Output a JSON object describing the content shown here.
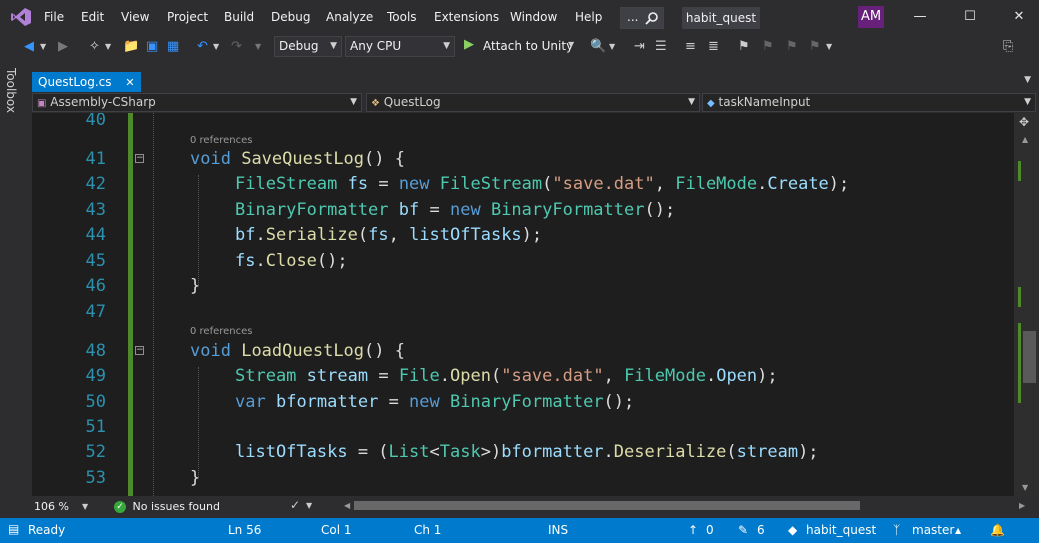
{
  "menu": {
    "items": [
      "File",
      "Edit",
      "View",
      "Project",
      "Build",
      "Debug",
      "Analyze",
      "Tools",
      "Extensions",
      "Window",
      "Help"
    ],
    "search_ellipsis": "...",
    "solution_name": "habit_quest",
    "avatar_initials": "AM"
  },
  "toolbar": {
    "configuration": "Debug",
    "platform": "Any CPU",
    "attach_label": "Attach to Unity"
  },
  "sidebar": {
    "toolbox_label": "Toolbox"
  },
  "tabs": {
    "active_file": "QuestLog.cs",
    "close_glyph": "✕"
  },
  "nav": {
    "project": "Assembly-CSharp",
    "type": "QuestLog",
    "member": "taskNameInput"
  },
  "editor": {
    "line_numbers": [
      "40",
      "41",
      "42",
      "43",
      "44",
      "45",
      "46",
      "47",
      "48",
      "49",
      "50",
      "51",
      "52",
      "53"
    ],
    "references": [
      "0 references",
      "0 references"
    ],
    "zoom": "106 %",
    "issues": "No issues found"
  },
  "status": {
    "state": "Ready",
    "line": "Ln 56",
    "col": "Col 1",
    "ch": "Ch 1",
    "mode": "INS",
    "push_count": "0",
    "changes_count": "6",
    "repo": "habit_quest",
    "branch": "master"
  },
  "colors": {
    "accent": "#007acc",
    "keyword": "#569cd6",
    "type": "#4ec9b0",
    "string": "#d69d85",
    "method": "#dcdcaa",
    "variable": "#9cdcfe",
    "line_number": "#2b91af"
  }
}
